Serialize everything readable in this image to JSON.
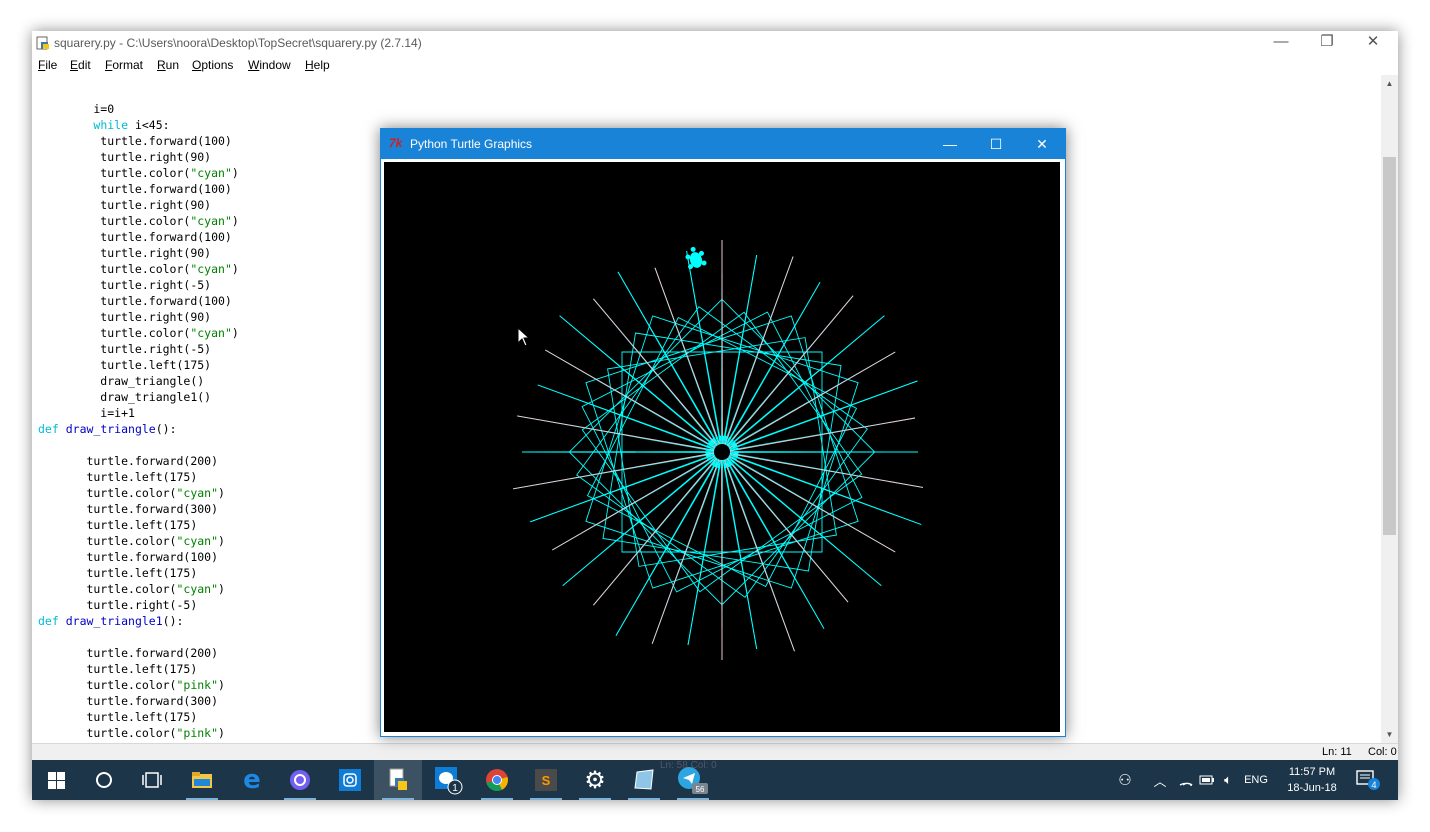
{
  "idle": {
    "title": "squarery.py - C:\\Users\\noora\\Desktop\\TopSecret\\squarery.py (2.7.14)",
    "window_controls": [
      "—",
      "❐",
      "✕"
    ],
    "menu": [
      "File",
      "Edit",
      "Format",
      "Run",
      "Options",
      "Window",
      "Help"
    ],
    "code_lines": [
      "        i=0",
      "        while i<45:",
      "         turtle.forward(100)",
      "         turtle.right(90)",
      "         turtle.color(\"cyan\")",
      "         turtle.forward(100)",
      "         turtle.right(90)",
      "         turtle.color(\"cyan\")",
      "         turtle.forward(100)",
      "         turtle.right(90)",
      "         turtle.color(\"cyan\")",
      "         turtle.right(-5)",
      "         turtle.forward(100)",
      "         turtle.right(90)",
      "         turtle.color(\"cyan\")",
      "         turtle.right(-5)",
      "         turtle.left(175)",
      "         draw_triangle()",
      "         draw_triangle1()",
      "         i=i+1",
      "def draw_triangle():",
      "",
      "       turtle.forward(200)",
      "       turtle.left(175)",
      "       turtle.color(\"cyan\")",
      "       turtle.forward(300)",
      "       turtle.left(175)",
      "       turtle.color(\"cyan\")",
      "       turtle.forward(100)",
      "       turtle.left(175)",
      "       turtle.color(\"cyan\")",
      "       turtle.right(-5)",
      "def draw_triangle1():",
      "",
      "       turtle.forward(200)",
      "       turtle.left(175)",
      "       turtle.color(\"pink\")",
      "       turtle.forward(300)",
      "       turtle.left(175)",
      "       turtle.color(\"pink\")"
    ],
    "status": {
      "ln": "Ln: 11",
      "col": "Col: 0"
    }
  },
  "turtle_window": {
    "icon_label": "7k",
    "title": "Python Turtle Graphics",
    "controls": [
      "—",
      "☐",
      "✕"
    ],
    "drawing_color": "#00ffff",
    "secondary_color": "#ffc0cb",
    "background_color": "#000000"
  },
  "taskbar": {
    "ghost_text": "Ln: 58   Col: 0",
    "language": "ENG",
    "time": "11:57 PM",
    "date": "18-Jun-18",
    "messenger_badge": "1",
    "telegram_badge": "56",
    "notification_badge": "4",
    "color": "#1d3548"
  },
  "colors": {
    "keyword": "#00bcd4",
    "function_name": "#0000c8",
    "string": "#008000"
  }
}
